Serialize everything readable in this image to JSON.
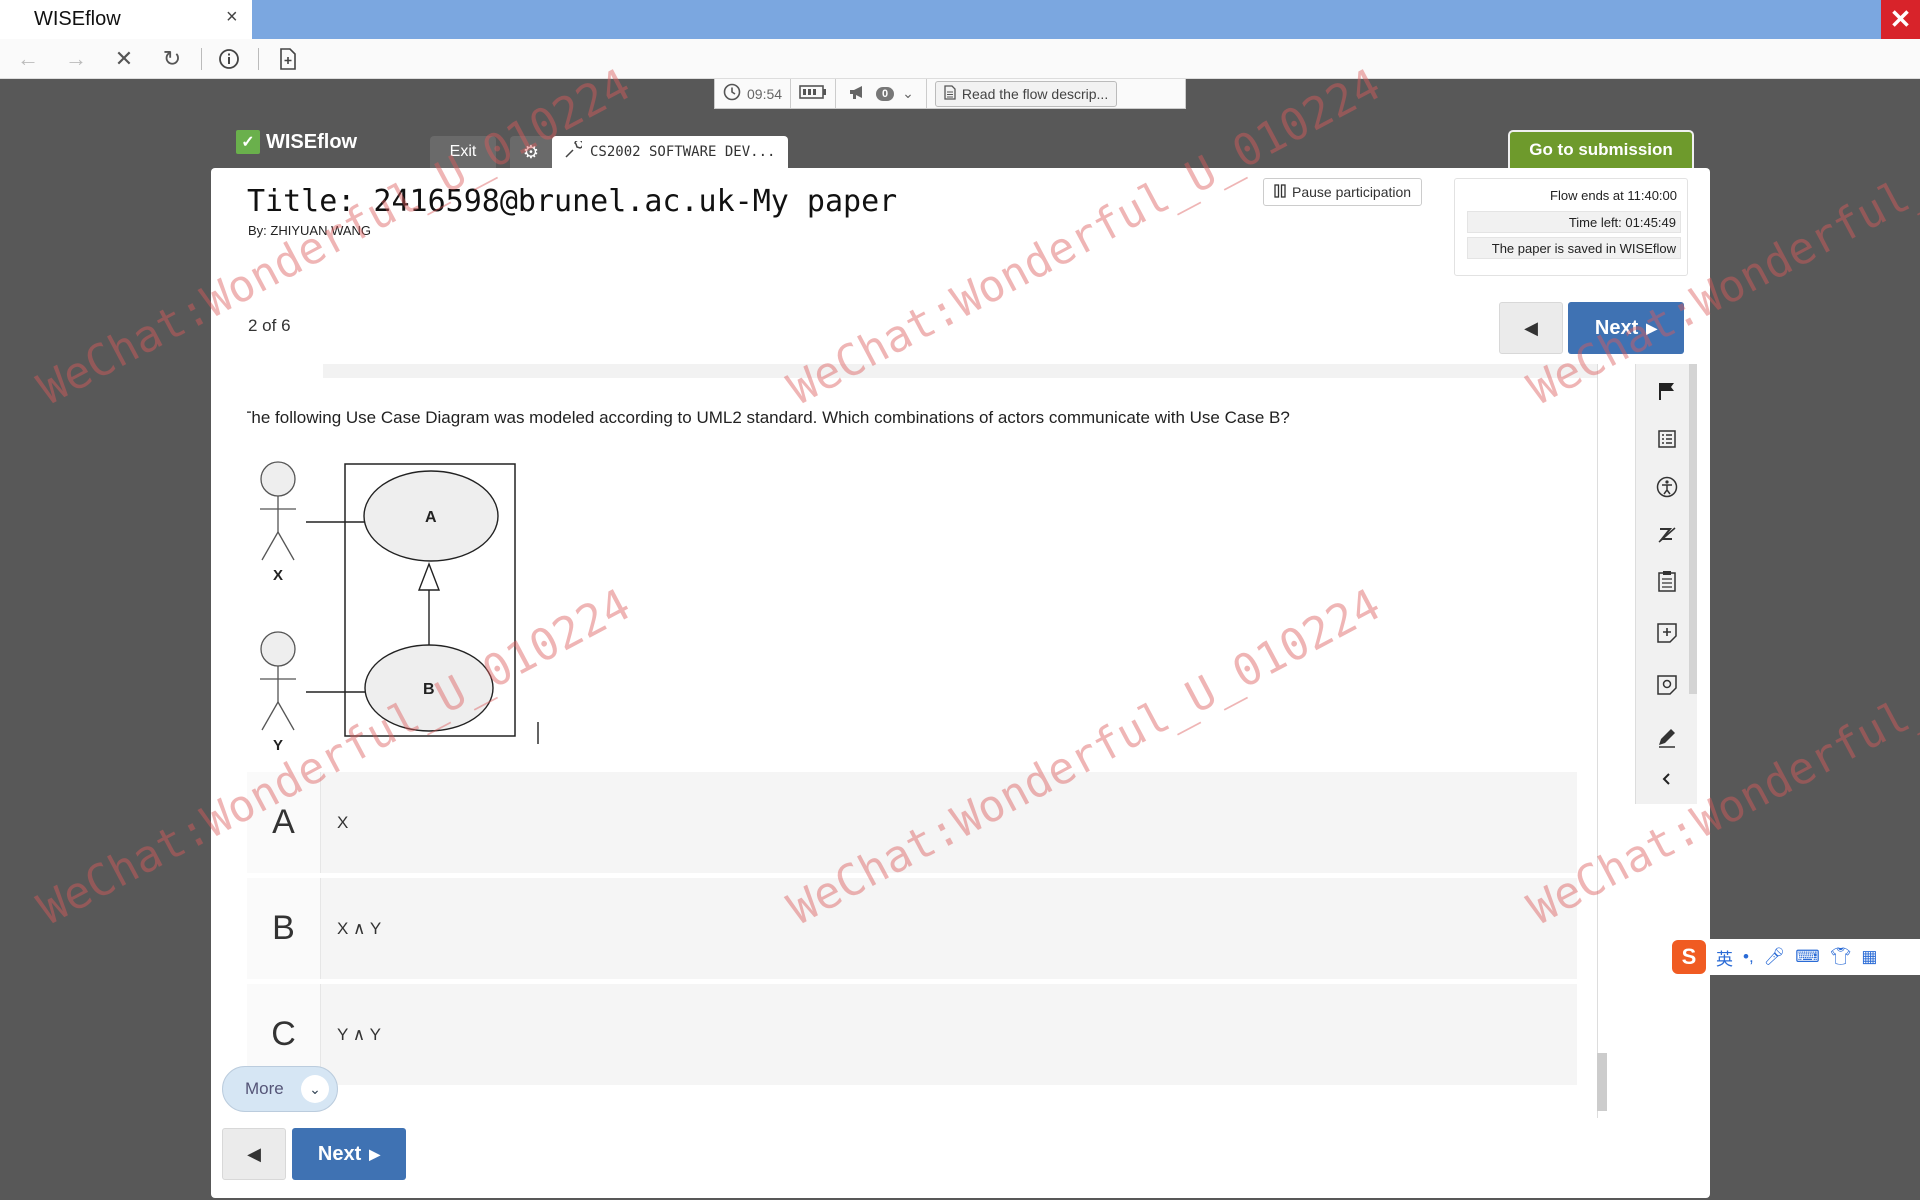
{
  "browser": {
    "tab_title": "WISEflow",
    "tab_close": "×",
    "window_close": "✕"
  },
  "statusbar": {
    "clock": "09:54",
    "notifications_count": "0",
    "flow_description": "Read the flow descrip..."
  },
  "header": {
    "logo_text": "WISEflow",
    "exit_label": "Exit",
    "course_tab": "CS2002 SOFTWARE DEV...",
    "goto_submission": "Go to submission"
  },
  "paper": {
    "title": "Title: 2416598@brunel.ac.uk-My paper",
    "by": "By: ZHIYUAN WANG",
    "pause_label": "Pause participation",
    "flow_ends": "Flow ends at 11:40:00",
    "time_left": "Time left:  01:45:49",
    "saved_status": "The paper is saved in WISEflow",
    "counter": "2 of 6",
    "next_label": "Next"
  },
  "question": {
    "text": "The following Use Case Diagram was modeled according to UML2 standard. Which combinations of actors communicate with Use Case B?",
    "diagram": {
      "actors": [
        "X",
        "Y"
      ],
      "use_cases": [
        "A",
        "B"
      ]
    },
    "options": [
      {
        "letter": "A",
        "text": "X"
      },
      {
        "letter": "B",
        "text": "X ∧ Y"
      },
      {
        "letter": "C",
        "text": "Y ∧ Y"
      }
    ],
    "more_label": "More"
  },
  "footer": {
    "next_label": "Next"
  },
  "rail": {
    "tools": [
      "flag-icon",
      "list-icon",
      "accessibility-icon",
      "zoom-icon",
      "clipboard-icon",
      "add-note-icon",
      "image-note-icon",
      "pencil-icon",
      "collapse-icon"
    ]
  },
  "ime": {
    "logo": "S",
    "lang": "英"
  },
  "watermark": {
    "text": "WeChat:Wonderful_U_010224"
  }
}
